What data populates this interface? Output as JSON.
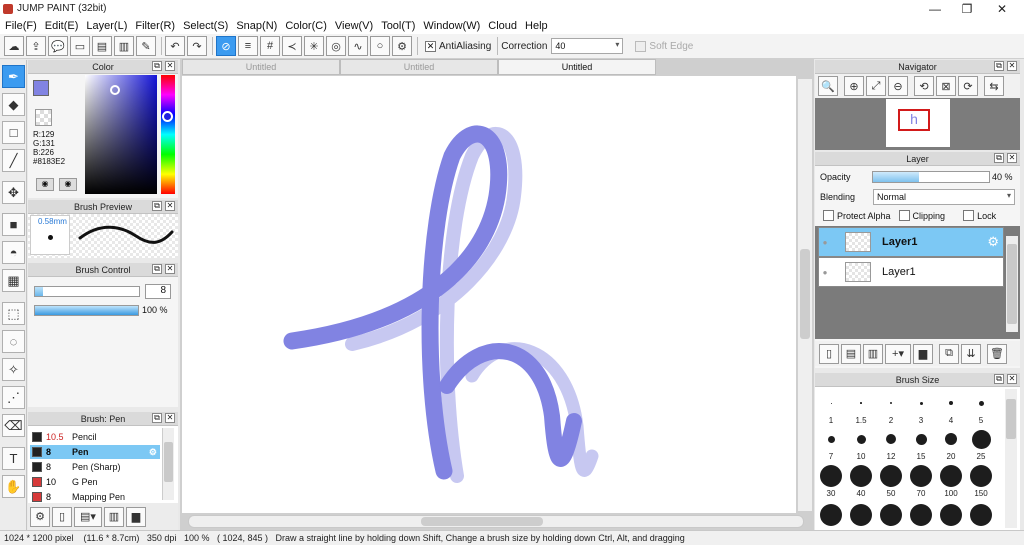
{
  "window": {
    "title": "JUMP PAINT (32bit)",
    "minimize": "—",
    "restore": "❐",
    "close": "✕"
  },
  "menu": [
    "File(F)",
    "Edit(E)",
    "Layer(L)",
    "Filter(R)",
    "Select(S)",
    "Snap(N)",
    "Color(C)",
    "View(V)",
    "Tool(T)",
    "Window(W)",
    "Cloud",
    "Help"
  ],
  "toolbar": {
    "antialiasing_label": "AntiAliasing",
    "antialiasing_checked": true,
    "correction_label": "Correction",
    "correction_value": "40",
    "soft_edge_label": "Soft Edge",
    "soft_edge_checked": false
  },
  "color_panel": {
    "title": "Color",
    "r": "R:129",
    "g": "G:131",
    "b": "B:226",
    "hex": "#8183E2",
    "fg_color": "#8183E2",
    "bg_color": "#2a2ab0"
  },
  "brush_preview": {
    "title": "Brush Preview",
    "size_label": "0.58mm"
  },
  "brush_control": {
    "title": "Brush Control",
    "size_value": "8",
    "size_fraction": 0.08,
    "opacity_label": "100 %",
    "opacity_fraction": 1.0
  },
  "brush_list": {
    "title": "Brush: Pen",
    "items": [
      {
        "size": "10.5",
        "name": "Pencil",
        "color": "#222222",
        "size_color": "#cc2222"
      },
      {
        "size": "8",
        "name": "Pen",
        "color": "#222222",
        "size_color": "#000000",
        "selected": true
      },
      {
        "size": "8",
        "name": "Pen (Sharp)",
        "color": "#222222",
        "size_color": "#000000"
      },
      {
        "size": "10",
        "name": "G Pen",
        "color": "#d63a3a",
        "size_color": "#000000"
      },
      {
        "size": "8",
        "name": "Mapping Pen",
        "color": "#d63a3a",
        "size_color": "#000000"
      }
    ]
  },
  "tabs": [
    {
      "label": "Untitled",
      "active": false
    },
    {
      "label": "Untitled",
      "active": false
    },
    {
      "label": "Untitled",
      "active": true
    }
  ],
  "navigator": {
    "title": "Navigator"
  },
  "layer_panel": {
    "title": "Layer",
    "opacity_label": "Opacity",
    "opacity_value": "40 %",
    "opacity_fraction": 0.4,
    "blending_label": "Blending",
    "blending_value": "Normal",
    "protect_alpha": "Protect Alpha",
    "clipping": "Clipping",
    "lock": "Lock",
    "layers": [
      {
        "name": "Layer1",
        "selected": true
      },
      {
        "name": "Layer1",
        "selected": false
      }
    ]
  },
  "brush_size": {
    "title": "Brush Size",
    "labels": [
      "1",
      "1.5",
      "2",
      "3",
      "4",
      "5",
      "7",
      "10",
      "12",
      "15",
      "20",
      "25",
      "30",
      "40",
      "50",
      "70",
      "100",
      "150"
    ]
  },
  "status": "1024 * 1200 pixel    (11.6 * 8.7cm)   350 dpi   100 %   ( 1024, 845 )   Draw a straight line by holding down Shift, Change a brush size by holding down Ctrl, Alt, and dragging"
}
